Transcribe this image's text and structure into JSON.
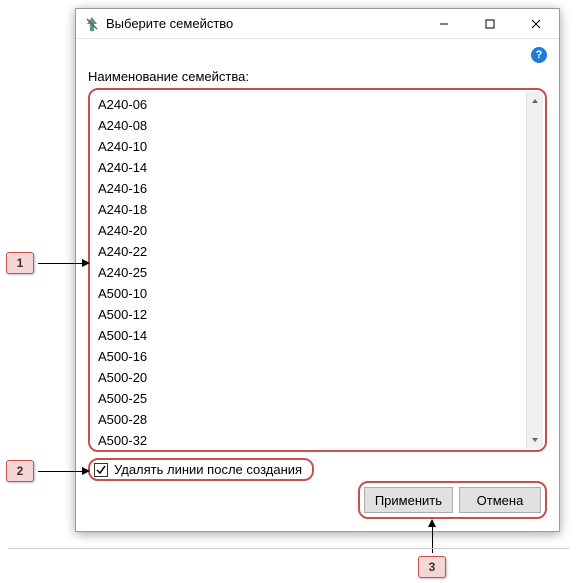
{
  "window": {
    "title": "Выберите семейство"
  },
  "label": "Наименование семейства:",
  "list": {
    "items": [
      "A240-06",
      "A240-08",
      "A240-10",
      "A240-14",
      "A240-16",
      "A240-18",
      "A240-20",
      "A240-22",
      "A240-25",
      "A500-10",
      "A500-12",
      "A500-14",
      "A500-16",
      "A500-20",
      "A500-25",
      "A500-28",
      "A500-32"
    ]
  },
  "checkbox": {
    "label": "Удалять линии после создания",
    "checked": true
  },
  "buttons": {
    "apply": "Применить",
    "cancel": "Отмена"
  },
  "callouts": {
    "one": "1",
    "two": "2",
    "three": "3"
  },
  "help": "?"
}
